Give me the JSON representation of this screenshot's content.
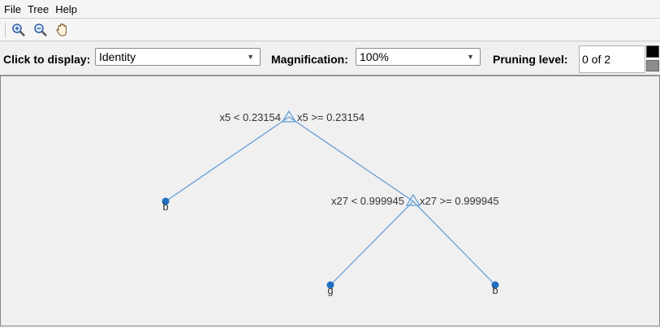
{
  "menu": {
    "items": [
      "File",
      "Tree",
      "Help"
    ]
  },
  "toolbar": {
    "buttons": [
      "zoom-in-icon",
      "zoom-out-icon",
      "pan-hand-icon"
    ]
  },
  "controls": {
    "display_label": "Click to display:",
    "display_value": "Identity",
    "magnification_label": "Magnification:",
    "magnification_value": "100%",
    "pruning_label": "Pruning level:",
    "pruning_value": "0 of 2"
  },
  "tree": {
    "root": {
      "left_rule": "x5 < 0.23154",
      "right_rule": "x5 >= 0.23154"
    },
    "node2": {
      "left_rule": "x27 < 0.999945",
      "right_rule": "x27 >= 0.999945"
    },
    "leaves": [
      "b",
      "g",
      "b"
    ],
    "colors": {
      "line": "#5b9bd5",
      "leaf": "#1f6fc0"
    }
  }
}
